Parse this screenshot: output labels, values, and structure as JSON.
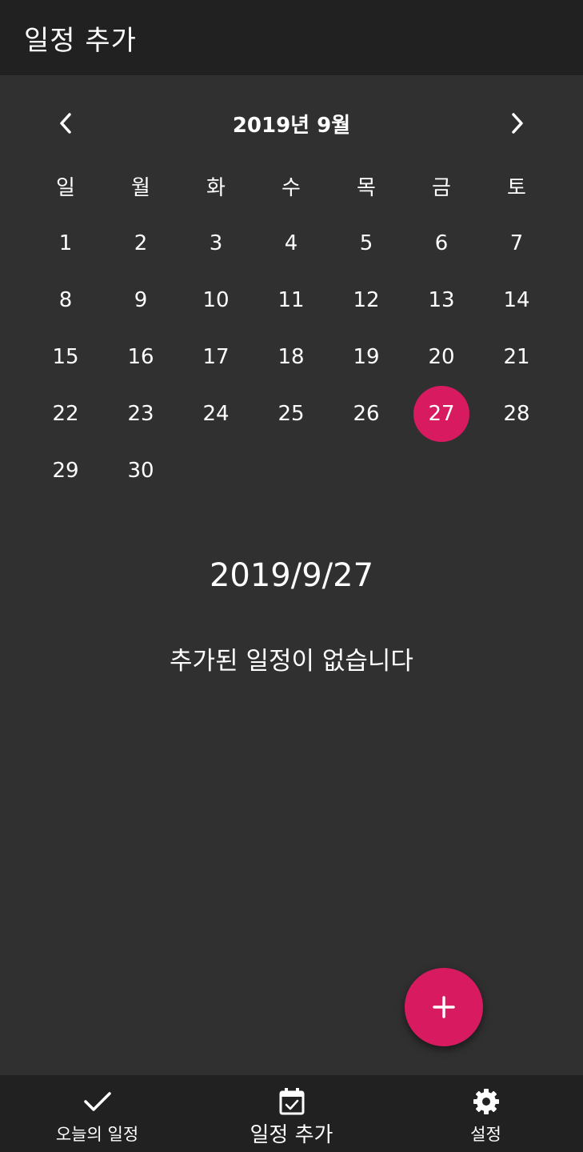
{
  "appbar": {
    "title": "일정 추가"
  },
  "calendar": {
    "month_title": "2019년 9월",
    "prev_icon": "chevron-left-icon",
    "next_icon": "chevron-right-icon",
    "weekdays": [
      "일",
      "월",
      "화",
      "수",
      "목",
      "금",
      "토"
    ],
    "days": [
      "1",
      "2",
      "3",
      "4",
      "5",
      "6",
      "7",
      "8",
      "9",
      "10",
      "11",
      "12",
      "13",
      "14",
      "15",
      "16",
      "17",
      "18",
      "19",
      "20",
      "21",
      "22",
      "23",
      "24",
      "25",
      "26",
      "27",
      "28",
      "29",
      "30"
    ],
    "selected_day": "27"
  },
  "selected_date": "2019/9/27",
  "empty_message": "추가된 일정이 없습니다",
  "fab": {
    "icon": "plus-icon"
  },
  "bottom_nav": {
    "items": [
      {
        "label": "오늘의 일정",
        "icon": "check-icon",
        "active": false
      },
      {
        "label": "일정 추가",
        "icon": "calendar-check-icon",
        "active": true
      },
      {
        "label": "설정",
        "icon": "gear-icon",
        "active": false
      }
    ]
  },
  "colors": {
    "accent": "#d81b60",
    "background": "#303030",
    "bar": "#212121",
    "text": "#ffffff"
  }
}
